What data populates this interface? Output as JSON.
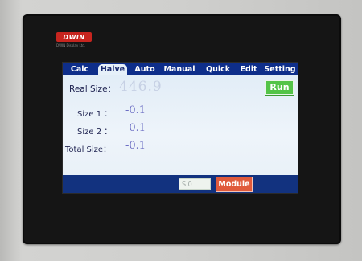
{
  "brand": {
    "logo_text": "DWIN",
    "tagline": "DWIN Display Ltd."
  },
  "tabs": [
    {
      "label": "Calc",
      "active": false
    },
    {
      "label": "Halve",
      "active": true
    },
    {
      "label": "Auto",
      "active": false
    },
    {
      "label": "Manual",
      "active": false
    },
    {
      "label": "Quick",
      "active": false
    },
    {
      "label": "Edit",
      "active": false
    },
    {
      "label": "Setting",
      "active": false
    }
  ],
  "main": {
    "real_size_label": "Real Size：",
    "real_size_value": "446.9",
    "run_label": "Run",
    "size1_label": "Size 1 ：",
    "size1_value": "-0.1",
    "size2_label": "Size 2 ：",
    "size2_value": "-0.1",
    "total_label": "Total Size：",
    "total_value": "-0.1"
  },
  "bottom": {
    "s_field_value": "S 0",
    "module_label": "Module"
  },
  "colors": {
    "tabbar": "#0e2e8a",
    "run_button": "#54c448",
    "module_button": "#e05a3c",
    "value_text": "#6d6fc4"
  }
}
